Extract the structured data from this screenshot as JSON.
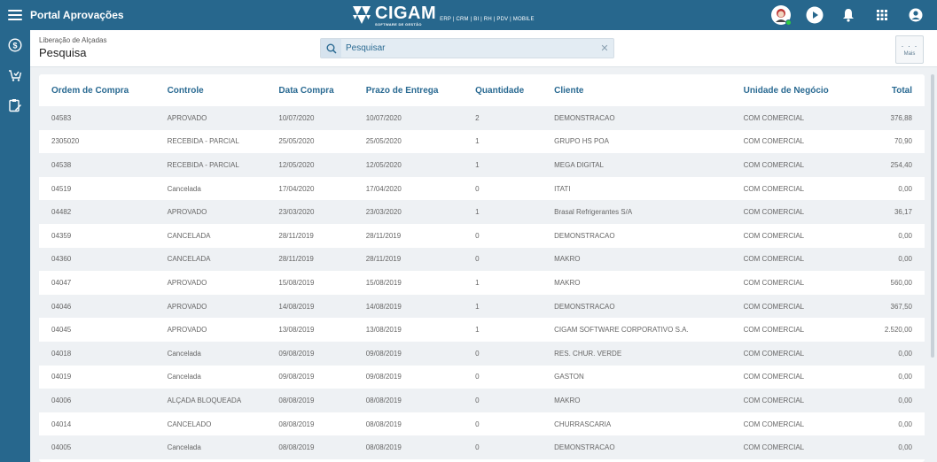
{
  "app": {
    "title": "Portal Aprovações",
    "brand": "CIGAM",
    "brand_sub": "SOFTWARE DE GESTÃO",
    "brand_modules": "ERP | CRM | BI | RH | PDV | MOBILE"
  },
  "header": {
    "breadcrumb": "Liberação de Alçadas",
    "page_title": "Pesquisa",
    "more_label": "Mais",
    "more_dots": "· · ·"
  },
  "search": {
    "placeholder": "Pesquisar",
    "value": ""
  },
  "colors": {
    "topbar": "#27678d",
    "accent": "#2a6a92"
  },
  "table": {
    "columns": [
      "Ordem de Compra",
      "Controle",
      "Data Compra",
      "Prazo de Entrega",
      "Quantidade",
      "Cliente",
      "Unidade de Negócio",
      "Total"
    ],
    "rows": [
      [
        "04583",
        "APROVADO",
        "10/07/2020",
        "10/07/2020",
        "2",
        "DEMONSTRACAO",
        "COM COMERCIAL",
        "376,88"
      ],
      [
        "2305020",
        "RECEBIDA - PARCIAL",
        "25/05/2020",
        "25/05/2020",
        "1",
        "GRUPO HS POA",
        "COM COMERCIAL",
        "70,90"
      ],
      [
        "04538",
        "RECEBIDA - PARCIAL",
        "12/05/2020",
        "12/05/2020",
        "1",
        "MEGA DIGITAL",
        "COM COMERCIAL",
        "254,40"
      ],
      [
        "04519",
        "Cancelada",
        "17/04/2020",
        "17/04/2020",
        "0",
        "ITATI",
        "COM COMERCIAL",
        "0,00"
      ],
      [
        "04482",
        "APROVADO",
        "23/03/2020",
        "23/03/2020",
        "1",
        "Brasal Refrigerantes S/A",
        "COM COMERCIAL",
        "36,17"
      ],
      [
        "04359",
        "CANCELADA",
        "28/11/2019",
        "28/11/2019",
        "0",
        "DEMONSTRACAO",
        "COM COMERCIAL",
        "0,00"
      ],
      [
        "04360",
        "CANCELADA",
        "28/11/2019",
        "28/11/2019",
        "0",
        "MAKRO",
        "COM COMERCIAL",
        "0,00"
      ],
      [
        "04047",
        "APROVADO",
        "15/08/2019",
        "15/08/2019",
        "1",
        "MAKRO",
        "COM COMERCIAL",
        "560,00"
      ],
      [
        "04046",
        "APROVADO",
        "14/08/2019",
        "14/08/2019",
        "1",
        "DEMONSTRACAO",
        "COM COMERCIAL",
        "367,50"
      ],
      [
        "04045",
        "APROVADO",
        "13/08/2019",
        "13/08/2019",
        "1",
        "CIGAM SOFTWARE CORPORATIVO S.A.",
        "COM COMERCIAL",
        "2.520,00"
      ],
      [
        "04018",
        "Cancelada",
        "09/08/2019",
        "09/08/2019",
        "0",
        "RES. CHUR. VERDE",
        "COM COMERCIAL",
        "0,00"
      ],
      [
        "04019",
        "Cancelada",
        "09/08/2019",
        "09/08/2019",
        "0",
        "GASTON",
        "COM COMERCIAL",
        "0,00"
      ],
      [
        "04006",
        "ALÇADA BLOQUEADA",
        "08/08/2019",
        "08/08/2019",
        "0",
        "MAKRO",
        "COM COMERCIAL",
        "0,00"
      ],
      [
        "04014",
        "CANCELADO",
        "08/08/2019",
        "08/08/2019",
        "0",
        "CHURRASCARIA",
        "COM COMERCIAL",
        "0,00"
      ],
      [
        "04005",
        "Cancelada",
        "08/08/2019",
        "08/08/2019",
        "0",
        "DEMONSTRACAO",
        "COM COMERCIAL",
        "0,00"
      ]
    ]
  }
}
